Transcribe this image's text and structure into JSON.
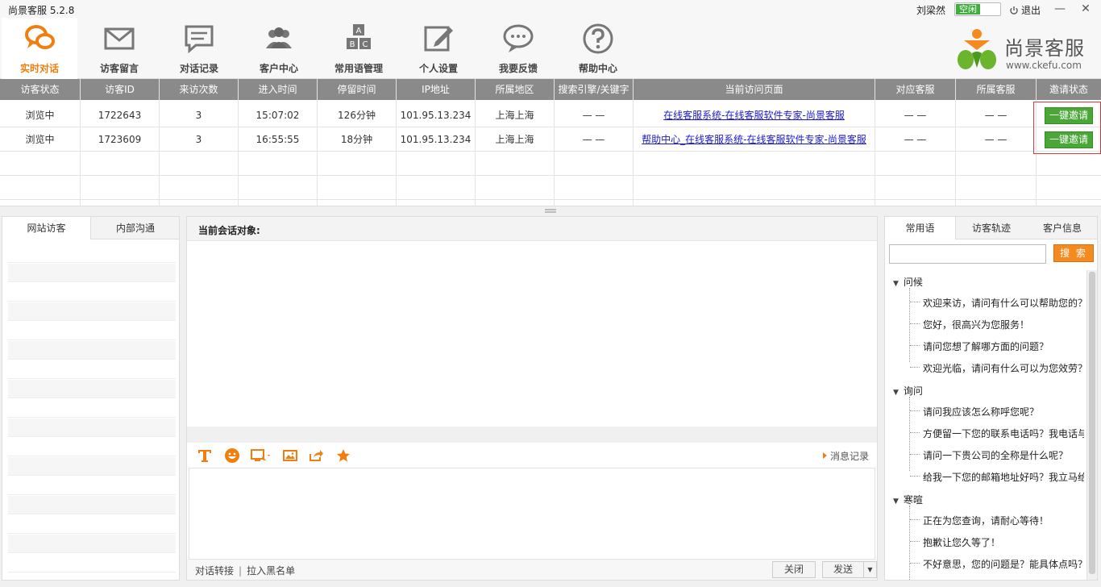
{
  "app": {
    "title": "尚景客服 5.2.8",
    "user": "刘梁然",
    "status": "空闲",
    "logout": "退出"
  },
  "toolbar": [
    {
      "label": "实时对话",
      "icon": "chat-bubbles-icon"
    },
    {
      "label": "访客留言",
      "icon": "envelope-icon"
    },
    {
      "label": "对话记录",
      "icon": "message-log-icon"
    },
    {
      "label": "客户中心",
      "icon": "users-icon"
    },
    {
      "label": "常用语管理",
      "icon": "abc-blocks-icon"
    },
    {
      "label": "个人设置",
      "icon": "edit-icon"
    },
    {
      "label": "我要反馈",
      "icon": "feedback-icon"
    },
    {
      "label": "帮助中心",
      "icon": "help-icon"
    }
  ],
  "logo": {
    "name": "尚景客服",
    "url": "www.ckefu.com"
  },
  "visitors": {
    "columns": [
      "访客状态",
      "访客ID",
      "来访次数",
      "进入时间",
      "停留时间",
      "IP地址",
      "所属地区",
      "搜索引擎/关键字",
      "当前访问页面",
      "对应客服",
      "所属客服",
      "邀请状态"
    ],
    "rows": [
      {
        "status": "浏览中",
        "id": "1722643",
        "visits": "3",
        "enter": "15:07:02",
        "stay": "126分钟",
        "ip": "101.95.13.234",
        "region": "上海上海",
        "search": "— —",
        "page": "在线客服系统-在线客服软件专家-尚景客服",
        "agent": "— —",
        "owner": "— —",
        "invite": "一键邀请"
      },
      {
        "status": "浏览中",
        "id": "1723609",
        "visits": "3",
        "enter": "16:55:55",
        "stay": "18分钟",
        "ip": "101.95.13.234",
        "region": "上海上海",
        "search": "— —",
        "page": "帮助中心_在线客服系统-在线客服软件专家-尚景客服",
        "agent": "— —",
        "owner": "— —",
        "invite": "一键邀请"
      }
    ]
  },
  "left": {
    "tabs": [
      "网站访客",
      "内部沟通"
    ]
  },
  "conversation": {
    "title": "当前会话对象:",
    "history": "消息记录",
    "transfer": "对话转接",
    "blacklist": "拉入黑名单",
    "close": "关闭",
    "send": "发送"
  },
  "right": {
    "tabs": [
      "常用语",
      "访客轨迹",
      "客户信息"
    ],
    "search_button": "搜 索",
    "groups": [
      {
        "name": "问候",
        "items": [
          "欢迎来访，请问有什么可以帮助您的？",
          "您好，很高兴为您服务！",
          "请问您想了解哪方面的问题？",
          "欢迎光临，请问有什么可以为您效劳？"
        ]
      },
      {
        "name": "询问",
        "items": [
          "请问我应该怎么称呼您呢？",
          "方便留一下您的联系电话吗？我电话与",
          "请问一下贵公司的全称是什么呢？",
          "给我一下您的邮箱地址好吗？我立马给"
        ]
      },
      {
        "name": "寒暄",
        "items": [
          "正在为您查询，请耐心等待！",
          "抱歉让您久等了！",
          "不好意思，您的问题是？能具体点吗？"
        ]
      }
    ]
  },
  "colors": {
    "accent": "#f07f10",
    "green": "#4aa637",
    "header_gray": "#8a8a8a"
  }
}
